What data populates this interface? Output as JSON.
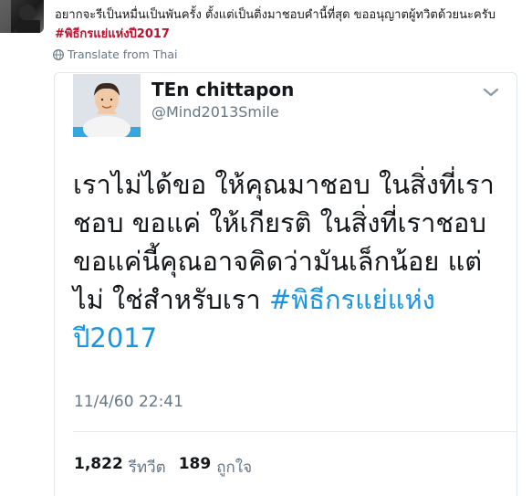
{
  "outer_tweet": {
    "text": "อยากจะรีเป็นหมื่นเป็นพันครั้ง ตั้งแต่เป็นติ่งมาชอบคำนี้ที่สุด ขออนุญาตผู้ทวิตด้วยนะครับ",
    "hashtag": "#พิธีกรแย่แห่งปี2017",
    "translate_label": "Translate from Thai"
  },
  "embedded_tweet": {
    "display_name": "TEn chittapon",
    "handle": "@Mind2013Smile",
    "lines": [
      "เราไม่ได้ขอ ให้คุณมาชอบ ในสิ่งที่เรา",
      "ชอบ ขอแค่ ให้เกียรติ ในสิ่งที่เราชอบ",
      "ขอแค่นี้คุณอาจคิดว่ามันเล็กน้อย แต่",
      "ไม่ ใช่สำหรับเรา "
    ],
    "hashtag_part1": "#พิธีกรแย่แห่ง",
    "hashtag_part2": "ปี2017",
    "timestamp": "11/4/60 22:41",
    "retweet_count": "1,822",
    "retweet_label": "รีทวีต",
    "like_count": "189",
    "like_label": "ถูกใจ"
  },
  "colors": {
    "hashtag_outer": "#c00f2c",
    "hashtag_link": "#1b95e0",
    "secondary_text": "#657786"
  }
}
